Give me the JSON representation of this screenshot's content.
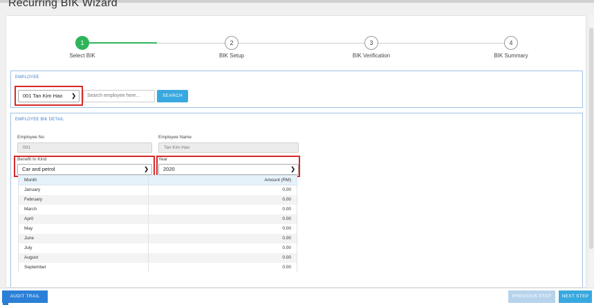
{
  "page": {
    "title": "Recurring BIK Wizard"
  },
  "stepper": {
    "steps": [
      {
        "number": "1",
        "label": "Select BIK",
        "active": true
      },
      {
        "number": "2",
        "label": "BIK Setup",
        "active": false
      },
      {
        "number": "3",
        "label": "BIK Verification",
        "active": false
      },
      {
        "number": "4",
        "label": "BIK Summary",
        "active": false
      }
    ]
  },
  "employee_panel": {
    "title": "EMPLOYEE",
    "selected_employee": "001 Tan Kim Hao",
    "search_placeholder": "Search employee here...",
    "search_button": "SEARCH"
  },
  "detail_panel": {
    "title": "EMPLOYEE BIK DETAIL",
    "employee_no_label": "Employee No",
    "employee_no_value": "001",
    "employee_name_label": "Employee Name",
    "employee_name_value": "Tan Kim Hao",
    "bik_label": "Benefit In Kind",
    "bik_value": "Car and petrol",
    "year_label": "Year",
    "year_value": "2020"
  },
  "table": {
    "headers": {
      "month": "Month",
      "amount": "Amount (RM)"
    },
    "rows": [
      {
        "month": "January",
        "amount": "0.00"
      },
      {
        "month": "February",
        "amount": "0.00"
      },
      {
        "month": "March",
        "amount": "0.00"
      },
      {
        "month": "April",
        "amount": "0.00"
      },
      {
        "month": "May",
        "amount": "0.00"
      },
      {
        "month": "June",
        "amount": "0.00"
      },
      {
        "month": "July",
        "amount": "0.00"
      },
      {
        "month": "August",
        "amount": "0.00"
      },
      {
        "month": "September",
        "amount": "0.00"
      }
    ]
  },
  "footer": {
    "audit_trail": "AUDIT TRAIL",
    "previous_step": "PREVIOUS STEP",
    "next_step": "NEXT STEP"
  },
  "icons": {
    "dropdown": "chevron-down-icon"
  },
  "colors": {
    "accent_green": "#2fb45a",
    "accent_blue": "#2b7fd6",
    "search_blue": "#38a8e0",
    "highlight_red": "#d62728"
  }
}
